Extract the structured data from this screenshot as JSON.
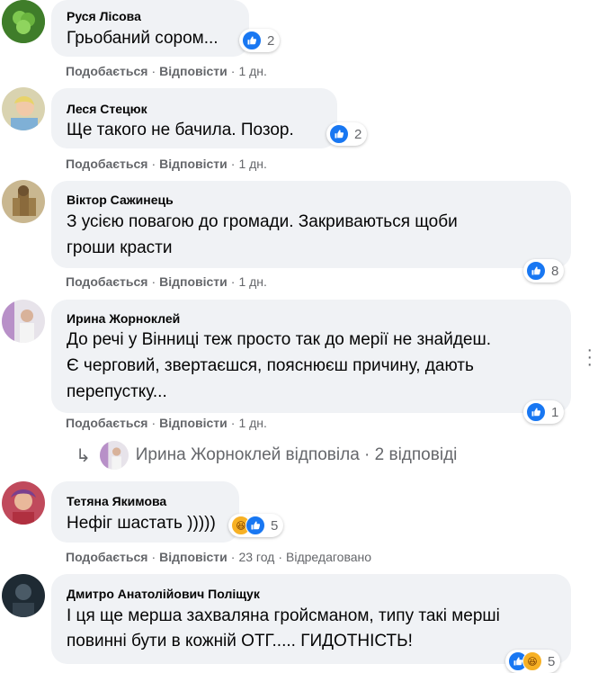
{
  "comments": [
    {
      "author": "Руся Лісова",
      "text_lines": [
        "Грьобаний сором..."
      ],
      "reactions": {
        "icons": [
          "like-icon"
        ],
        "count": "2"
      },
      "actions": {
        "like": "Подобається",
        "reply": "Відповісти",
        "time": "1 дн."
      }
    },
    {
      "author": "Леся Стецюк",
      "text_lines": [
        "Ще такого не бачила. Позор."
      ],
      "reactions": {
        "icons": [
          "like-icon"
        ],
        "count": "2"
      },
      "actions": {
        "like": "Подобається",
        "reply": "Відповісти",
        "time": "1 дн."
      }
    },
    {
      "author": "Віктор Сажинець",
      "text_lines": [
        "З усією повагою до громади. Закриваються щоби",
        "гроши красти"
      ],
      "reactions": {
        "icons": [
          "like-icon"
        ],
        "count": "8"
      },
      "actions": {
        "like": "Подобається",
        "reply": "Відповісти",
        "time": "1 дн."
      }
    },
    {
      "author": "Ирина Жорноклей",
      "text_lines": [
        "До речі у Вінниці теж просто так до мерії не знайдеш.",
        "Є черговий, звертаєшся, пояснюєш причину, дають",
        "перепустку..."
      ],
      "reactions": {
        "icons": [
          "like-icon"
        ],
        "count": "1"
      },
      "actions": {
        "like": "Подобається",
        "reply": "Відповісти",
        "time": "1 дн."
      },
      "replies_summary": "Ирина Жорноклей відповіла · 2 відповіді"
    },
    {
      "author": "Тетяна Якимова",
      "text_lines": [
        "Нефіг шастать )))))"
      ],
      "reactions": {
        "icons": [
          "haha-icon",
          "like-icon"
        ],
        "count": "5"
      },
      "actions": {
        "like": "Подобається",
        "reply": "Відповісти",
        "time": "23 год",
        "edited": "Відредаговано"
      }
    },
    {
      "author": "Дмитро Анатолійович Поліщук",
      "text_lines": [
        "І ця ще мерша захваляна гройсманом, типу такі мерші",
        "повинні бути в кожній ОТГ..... ГИДОТНІСТЬ!"
      ],
      "reactions": {
        "icons": [
          "like-icon",
          "haha-icon"
        ],
        "count": "5"
      }
    }
  ],
  "colors": {
    "bubble": "#f0f2f5",
    "meta": "#65676b",
    "like": "#1877f2",
    "haha": "#f7b125"
  }
}
